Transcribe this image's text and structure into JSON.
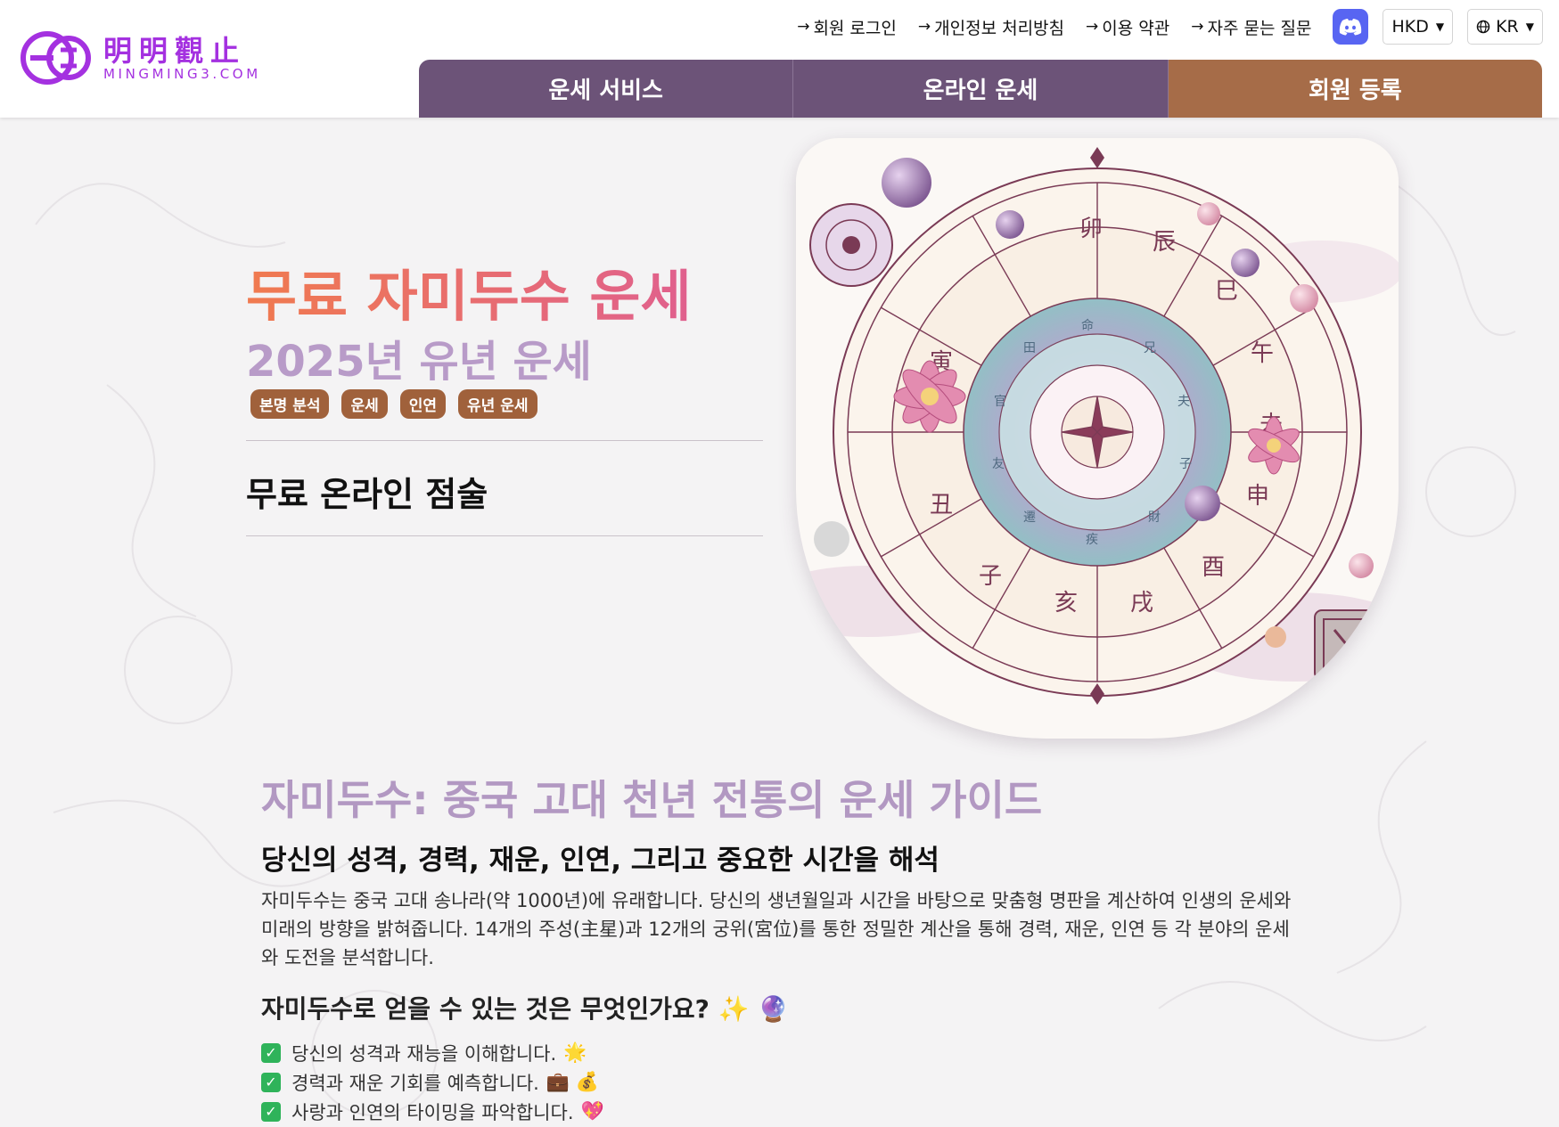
{
  "brand": {
    "name_cn": "明明觀止",
    "domain": "MINGMING3.COM",
    "color": "#a431e0"
  },
  "topnav": {
    "links": [
      {
        "label": "회원 로그인",
        "icon": "arrow-right-icon"
      },
      {
        "label": "개인정보 처리방침",
        "icon": "arrow-right-icon"
      },
      {
        "label": "이용 약관",
        "icon": "arrow-right-icon"
      },
      {
        "label": "자주 묻는 질문",
        "icon": "arrow-right-icon"
      }
    ],
    "discord_icon": "discord-icon",
    "currency": "HKD",
    "language": "KR"
  },
  "mainnav": {
    "tabs": [
      "운세 서비스",
      "온라인 운세",
      "회원 등록"
    ],
    "colors": {
      "primary": "#6c5378",
      "accent": "#a66c48"
    }
  },
  "hero": {
    "title": "무료 자미두수 운세",
    "subtitle": "2025년 유년 운세",
    "tags": [
      "본명 분석",
      "운세",
      "인연",
      "유년 운세"
    ],
    "section_heading": "무료 온라인 점술",
    "image": "ziwei-astrology-wheel-illustration"
  },
  "content": {
    "title": "자미두수: 중국 고대 천년 전통의 운세 가이드",
    "subtitle": "당신의 성격, 경력, 재운, 인연, 그리고 중요한 시간을 해석",
    "paragraph": "자미두수는 중국 고대 송나라(약 1000년)에 유래합니다. 당신의 생년월일과 시간을 바탕으로 맞춤형 명판을 계산하여 인생의 운세와 미래의 방향을 밝혀줍니다. 14개의 주성(主星)과 12개의 궁위(宮位)를 통한 정밀한 계산을 통해 경력, 재운, 인연 등 각 분야의 운세와 도전을 분석합니다.",
    "question": "자미두수로 얻을 수 있는 것은 무엇인가요? ✨ 🔮",
    "benefits": [
      {
        "text": "당신의 성격과 재능을 이해합니다.",
        "emoji": "🌟"
      },
      {
        "text": "경력과 재운 기회를 예측합니다.",
        "emoji": "💼 💰"
      },
      {
        "text": "사랑과 인연의 타이밍을 파악합니다.",
        "emoji": "💖"
      }
    ]
  }
}
